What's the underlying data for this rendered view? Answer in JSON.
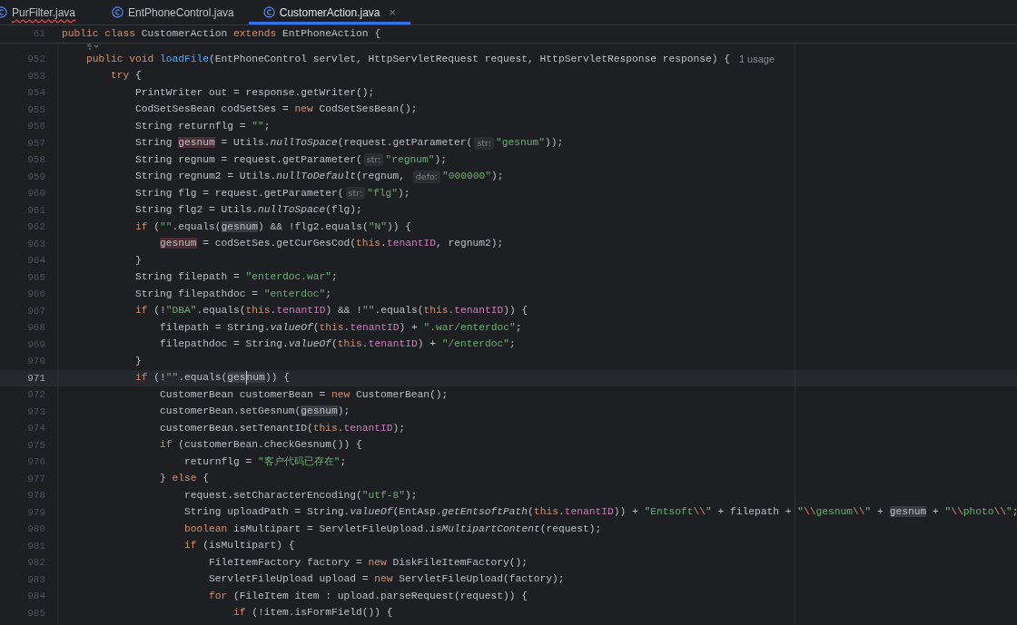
{
  "tabs": [
    {
      "label": "PurFilter.java",
      "selected": false,
      "error": true
    },
    {
      "label": "EntPhoneControl.java",
      "selected": false,
      "error": false
    },
    {
      "label": "CustomerAction.java",
      "selected": true,
      "error": false,
      "close": "×"
    }
  ],
  "sticky_line": {
    "number": "61",
    "tokens": [
      {
        "text": "public ",
        "kind": "kw"
      },
      {
        "text": "class",
        "kind": "kw"
      },
      {
        "text": " CustomerAction ",
        "kind": "plain"
      },
      {
        "text": "extends",
        "kind": "kw"
      },
      {
        "text": " EntPhoneAction {",
        "kind": "plain"
      }
    ]
  },
  "lines": [
    {
      "number": "952",
      "current": false,
      "tokens": [
        {
          "text": "    public ",
          "kind": "kw"
        },
        {
          "text": "void ",
          "kind": "kw"
        },
        {
          "text": "loadFile",
          "kind": "decl"
        },
        {
          "text": "(EntPhoneControl servlet, HttpServletRequest request, HttpServletResponse response) {",
          "kind": "plain"
        },
        {
          "text": "1 usage",
          "kind": "usage"
        }
      ]
    },
    {
      "number": "953",
      "current": false,
      "tokens": [
        {
          "text": "        try",
          "kind": "kw"
        },
        {
          "text": " {",
          "kind": "plain"
        }
      ]
    },
    {
      "number": "954",
      "current": false,
      "tokens": [
        {
          "text": "            PrintWriter out = response.getWriter();",
          "kind": "plain"
        }
      ]
    },
    {
      "number": "955",
      "current": false,
      "tokens": [
        {
          "text": "            CodSetSesBean codSetSes = ",
          "kind": "plain"
        },
        {
          "text": "new",
          "kind": "kw"
        },
        {
          "text": " CodSetSesBean();",
          "kind": "plain"
        }
      ]
    },
    {
      "number": "956",
      "current": false,
      "tokens": [
        {
          "text": "            String returnflg = ",
          "kind": "plain"
        },
        {
          "text": "\"\"",
          "kind": "str"
        },
        {
          "text": ";",
          "kind": "plain"
        }
      ]
    },
    {
      "number": "957",
      "current": false,
      "tokens": [
        {
          "text": "            String ",
          "kind": "plain"
        },
        {
          "text": "gesnum",
          "kind": "write"
        },
        {
          "text": " = Utils.",
          "kind": "plain"
        },
        {
          "text": "nullToSpace",
          "kind": "static"
        },
        {
          "text": "(request.getParameter(",
          "kind": "plain"
        },
        {
          "text": "str:",
          "kind": "hint"
        },
        {
          "text": "\"gesnum\"",
          "kind": "str"
        },
        {
          "text": "));",
          "kind": "plain"
        }
      ]
    },
    {
      "number": "958",
      "current": false,
      "tokens": [
        {
          "text": "            String regnum = request.getParameter(",
          "kind": "plain"
        },
        {
          "text": "str:",
          "kind": "hint"
        },
        {
          "text": "\"regnum\"",
          "kind": "str"
        },
        {
          "text": ");",
          "kind": "plain"
        }
      ]
    },
    {
      "number": "959",
      "current": false,
      "tokens": [
        {
          "text": "            String regnum2 = Utils.",
          "kind": "plain"
        },
        {
          "text": "nullToDefault",
          "kind": "static"
        },
        {
          "text": "(regnum, ",
          "kind": "plain"
        },
        {
          "text": "defo:",
          "kind": "hint"
        },
        {
          "text": "\"000000\"",
          "kind": "str"
        },
        {
          "text": ");",
          "kind": "plain"
        }
      ]
    },
    {
      "number": "960",
      "current": false,
      "tokens": [
        {
          "text": "            String flg = request.getParameter(",
          "kind": "plain"
        },
        {
          "text": "str:",
          "kind": "hint"
        },
        {
          "text": "\"flg\"",
          "kind": "str"
        },
        {
          "text": ");",
          "kind": "plain"
        }
      ]
    },
    {
      "number": "961",
      "current": false,
      "tokens": [
        {
          "text": "            String flg2 = Utils.",
          "kind": "plain"
        },
        {
          "text": "nullToSpace",
          "kind": "static"
        },
        {
          "text": "(flg);",
          "kind": "plain"
        }
      ]
    },
    {
      "number": "962",
      "current": false,
      "tokens": [
        {
          "text": "            if",
          "kind": "kw"
        },
        {
          "text": " (",
          "kind": "plain"
        },
        {
          "text": "\"\"",
          "kind": "str"
        },
        {
          "text": ".equals(",
          "kind": "plain"
        },
        {
          "text": "gesnum",
          "kind": "read"
        },
        {
          "text": ") && !flg2.equals(",
          "kind": "plain"
        },
        {
          "text": "\"N\"",
          "kind": "str"
        },
        {
          "text": ")) {",
          "kind": "plain"
        }
      ]
    },
    {
      "number": "963",
      "current": false,
      "tokens": [
        {
          "text": "                gesnum",
          "kind": "write"
        },
        {
          "text": " = codSetSes.getCurGesCod(",
          "kind": "plain"
        },
        {
          "text": "this",
          "kind": "kw"
        },
        {
          "text": ".",
          "kind": "plain"
        },
        {
          "text": "tenantID",
          "kind": "field"
        },
        {
          "text": ", regnum2);",
          "kind": "plain"
        }
      ]
    },
    {
      "number": "964",
      "current": false,
      "tokens": [
        {
          "text": "            }",
          "kind": "plain"
        }
      ]
    },
    {
      "number": "965",
      "current": false,
      "tokens": [
        {
          "text": "            String filepath = ",
          "kind": "plain"
        },
        {
          "text": "\"enterdoc.war\"",
          "kind": "str"
        },
        {
          "text": ";",
          "kind": "plain"
        }
      ]
    },
    {
      "number": "966",
      "current": false,
      "tokens": [
        {
          "text": "            String filepathdoc = ",
          "kind": "plain"
        },
        {
          "text": "\"enterdoc\"",
          "kind": "str"
        },
        {
          "text": ";",
          "kind": "plain"
        }
      ]
    },
    {
      "number": "967",
      "current": false,
      "tokens": [
        {
          "text": "            if",
          "kind": "kw"
        },
        {
          "text": " (!",
          "kind": "plain"
        },
        {
          "text": "\"DBA\"",
          "kind": "str"
        },
        {
          "text": ".equals(",
          "kind": "plain"
        },
        {
          "text": "this",
          "kind": "kw"
        },
        {
          "text": ".",
          "kind": "plain"
        },
        {
          "text": "tenantID",
          "kind": "field"
        },
        {
          "text": ") && !",
          "kind": "plain"
        },
        {
          "text": "\"\"",
          "kind": "str"
        },
        {
          "text": ".equals(",
          "kind": "plain"
        },
        {
          "text": "this",
          "kind": "kw"
        },
        {
          "text": ".",
          "kind": "plain"
        },
        {
          "text": "tenantID",
          "kind": "field"
        },
        {
          "text": ")) {",
          "kind": "plain"
        }
      ]
    },
    {
      "number": "968",
      "current": false,
      "tokens": [
        {
          "text": "                filepath = String.",
          "kind": "plain"
        },
        {
          "text": "valueOf",
          "kind": "static"
        },
        {
          "text": "(",
          "kind": "plain"
        },
        {
          "text": "this",
          "kind": "kw"
        },
        {
          "text": ".",
          "kind": "plain"
        },
        {
          "text": "tenantID",
          "kind": "field"
        },
        {
          "text": ") + ",
          "kind": "plain"
        },
        {
          "text": "\".war/enterdoc\"",
          "kind": "str"
        },
        {
          "text": ";",
          "kind": "plain"
        }
      ]
    },
    {
      "number": "969",
      "current": false,
      "tokens": [
        {
          "text": "                filepathdoc = String.",
          "kind": "plain"
        },
        {
          "text": "valueOf",
          "kind": "static"
        },
        {
          "text": "(",
          "kind": "plain"
        },
        {
          "text": "this",
          "kind": "kw"
        },
        {
          "text": ".",
          "kind": "plain"
        },
        {
          "text": "tenantID",
          "kind": "field"
        },
        {
          "text": ") + ",
          "kind": "plain"
        },
        {
          "text": "\"/enterdoc\"",
          "kind": "str"
        },
        {
          "text": ";",
          "kind": "plain"
        }
      ]
    },
    {
      "number": "970",
      "current": false,
      "tokens": [
        {
          "text": "            }",
          "kind": "plain"
        }
      ]
    },
    {
      "number": "971",
      "current": true,
      "tokens": [
        {
          "text": "            if",
          "kind": "kw"
        },
        {
          "text": " (!",
          "kind": "plain"
        },
        {
          "text": "\"\"",
          "kind": "str"
        },
        {
          "text": ".equals(",
          "kind": "plain"
        },
        {
          "text": "ges",
          "kind": "read"
        },
        {
          "kind": "caret"
        },
        {
          "text": "num",
          "kind": "read"
        },
        {
          "text": ")) {",
          "kind": "plain"
        }
      ]
    },
    {
      "number": "972",
      "current": false,
      "tokens": [
        {
          "text": "                CustomerBean customerBean = ",
          "kind": "plain"
        },
        {
          "text": "new",
          "kind": "kw"
        },
        {
          "text": " CustomerBean();",
          "kind": "plain"
        }
      ]
    },
    {
      "number": "973",
      "current": false,
      "tokens": [
        {
          "text": "                customerBean.setGesnum(",
          "kind": "plain"
        },
        {
          "text": "gesnum",
          "kind": "read"
        },
        {
          "text": ");",
          "kind": "plain"
        }
      ]
    },
    {
      "number": "974",
      "current": false,
      "tokens": [
        {
          "text": "                customerBean.setTenantID(",
          "kind": "plain"
        },
        {
          "text": "this",
          "kind": "kw"
        },
        {
          "text": ".",
          "kind": "plain"
        },
        {
          "text": "tenantID",
          "kind": "field"
        },
        {
          "text": ");",
          "kind": "plain"
        }
      ]
    },
    {
      "number": "975",
      "current": false,
      "tokens": [
        {
          "text": "                if",
          "kind": "kw"
        },
        {
          "text": " (customerBean.checkGesnum()) {",
          "kind": "plain"
        }
      ]
    },
    {
      "number": "976",
      "current": false,
      "tokens": [
        {
          "text": "                    returnflg = ",
          "kind": "plain"
        },
        {
          "text": "\"客户代码已存在\"",
          "kind": "str"
        },
        {
          "text": ";",
          "kind": "plain"
        }
      ]
    },
    {
      "number": "977",
      "current": false,
      "tokens": [
        {
          "text": "                } ",
          "kind": "plain"
        },
        {
          "text": "else",
          "kind": "kw"
        },
        {
          "text": " {",
          "kind": "plain"
        }
      ]
    },
    {
      "number": "978",
      "current": false,
      "tokens": [
        {
          "text": "                    request.setCharacterEncoding(",
          "kind": "plain"
        },
        {
          "text": "\"utf-8\"",
          "kind": "str"
        },
        {
          "text": ");",
          "kind": "plain"
        }
      ]
    },
    {
      "number": "979",
      "current": false,
      "tokens": [
        {
          "text": "                    String uploadPath = String.",
          "kind": "plain"
        },
        {
          "text": "valueOf",
          "kind": "static"
        },
        {
          "text": "(EntAsp.",
          "kind": "plain"
        },
        {
          "text": "getEntsoftPath",
          "kind": "static"
        },
        {
          "text": "(",
          "kind": "plain"
        },
        {
          "text": "this",
          "kind": "kw"
        },
        {
          "text": ".",
          "kind": "plain"
        },
        {
          "text": "tenantID",
          "kind": "field"
        },
        {
          "text": ")) + ",
          "kind": "plain"
        },
        {
          "text": "\"Entsoft",
          "kind": "str"
        },
        {
          "text": "\\\\",
          "kind": "esc"
        },
        {
          "text": "\"",
          "kind": "str"
        },
        {
          "text": " + filepath + ",
          "kind": "plain"
        },
        {
          "text": "\"",
          "kind": "str"
        },
        {
          "text": "\\\\",
          "kind": "esc"
        },
        {
          "text": "gesnum",
          "kind": "str"
        },
        {
          "text": "\\\\",
          "kind": "esc"
        },
        {
          "text": "\"",
          "kind": "str"
        },
        {
          "text": " + ",
          "kind": "plain"
        },
        {
          "text": "gesnum",
          "kind": "read"
        },
        {
          "text": " + ",
          "kind": "plain"
        },
        {
          "text": "\"",
          "kind": "str"
        },
        {
          "text": "\\\\",
          "kind": "esc"
        },
        {
          "text": "photo",
          "kind": "str"
        },
        {
          "text": "\\\\",
          "kind": "esc"
        },
        {
          "text": "\"",
          "kind": "str"
        },
        {
          "text": ";",
          "kind": "plain"
        }
      ]
    },
    {
      "number": "980",
      "current": false,
      "tokens": [
        {
          "text": "                    boolean",
          "kind": "kw"
        },
        {
          "text": " isMultipart = ServletFileUpload.",
          "kind": "plain"
        },
        {
          "text": "isMultipartContent",
          "kind": "static"
        },
        {
          "text": "(request);",
          "kind": "plain"
        }
      ]
    },
    {
      "number": "981",
      "current": false,
      "tokens": [
        {
          "text": "                    if",
          "kind": "kw"
        },
        {
          "text": " (isMultipart) {",
          "kind": "plain"
        }
      ]
    },
    {
      "number": "982",
      "current": false,
      "tokens": [
        {
          "text": "                        FileItemFactory factory = ",
          "kind": "plain"
        },
        {
          "text": "new",
          "kind": "kw"
        },
        {
          "text": " DiskFileItemFactory();",
          "kind": "plain"
        }
      ]
    },
    {
      "number": "983",
      "current": false,
      "tokens": [
        {
          "text": "                        ServletFileUpload upload = ",
          "kind": "plain"
        },
        {
          "text": "new",
          "kind": "kw"
        },
        {
          "text": " ServletFileUpload(factory);",
          "kind": "plain"
        }
      ]
    },
    {
      "number": "984",
      "current": false,
      "tokens": [
        {
          "text": "                        for",
          "kind": "kw"
        },
        {
          "text": " (FileItem item : upload.parseRequest(request)) {",
          "kind": "plain"
        }
      ]
    },
    {
      "number": "985",
      "current": false,
      "tokens": [
        {
          "text": "                            if",
          "kind": "kw"
        },
        {
          "text": " (!item.isFormField()) {",
          "kind": "plain"
        }
      ]
    }
  ]
}
